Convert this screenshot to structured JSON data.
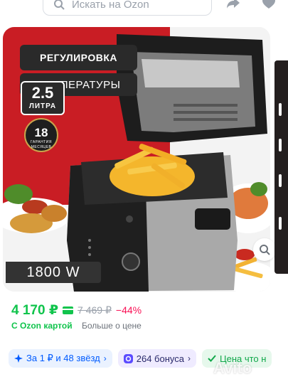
{
  "search": {
    "placeholder": "Искать на Ozon"
  },
  "banner": {
    "headline_line1": "РЕГУЛИРОВКА",
    "headline_line2": "ТЕМПЕРАТУРЫ",
    "volume_value": "2.5",
    "volume_unit": "ЛИТРА",
    "warranty_value": "18",
    "warranty_text": "ГАРАНТИЯ МЕСЯЦЕВ",
    "power": "1800 W"
  },
  "price": {
    "current": "4 170 ₽",
    "old": "7 469 ₽",
    "discount": "−44%",
    "card_note": "С Ozon картой",
    "more_link": "Больше о цене"
  },
  "chips": [
    {
      "label": "За 1 ₽ и 48 звёзд"
    },
    {
      "label": "264 бонуса"
    },
    {
      "label": "Цена что н"
    }
  ],
  "watermark": "Avito",
  "colors": {
    "ozon_green": "#10c44c",
    "ozon_blue": "#005bff",
    "discount_red": "#f91155"
  }
}
